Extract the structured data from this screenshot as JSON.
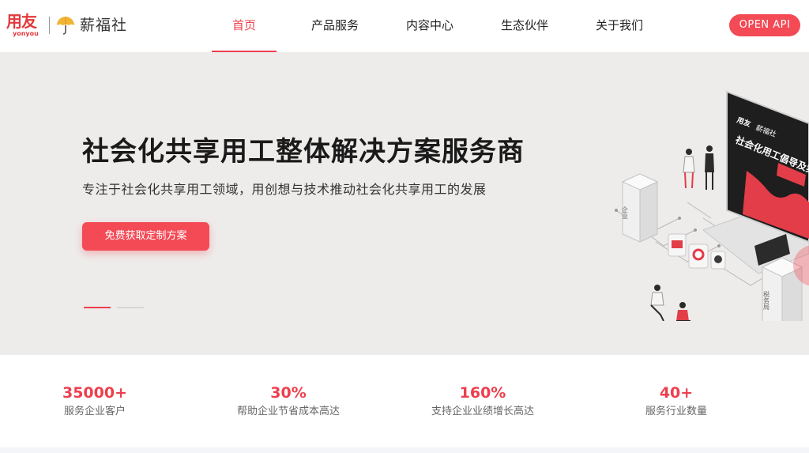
{
  "brand": {
    "yonyou_cn": "用友",
    "yonyou_en": "yonyou",
    "product_name": "薪福社"
  },
  "nav": {
    "items": [
      {
        "label": "首页",
        "active": true
      },
      {
        "label": "产品服务",
        "active": false
      },
      {
        "label": "内容中心",
        "active": false
      },
      {
        "label": "生态伙伴",
        "active": false
      },
      {
        "label": "关于我们",
        "active": false
      }
    ],
    "open_api_label": "OPEN API"
  },
  "hero": {
    "title": "社会化共享用工整体解决方案服务商",
    "subtitle": "专注于社会化共享用工领域，用创想与技术推动社会化共享用工的发展",
    "cta_label": "免费获取定制方案",
    "carousel_active_index": 0,
    "carousel_count": 2,
    "illustration": {
      "screen_brand_cn": "用友",
      "screen_brand_product": "薪福社",
      "screen_headline": "社会化用工倡导及实",
      "server_left_label": "企业",
      "server_right_label": "税务局"
    }
  },
  "stats": [
    {
      "value": "35000+",
      "label": "服务企业客户"
    },
    {
      "value": "30%",
      "label": "帮助企业节省成本高达"
    },
    {
      "value": "160%",
      "label": "支持企业业绩增长高达"
    },
    {
      "value": "40+",
      "label": "服务行业数量"
    }
  ],
  "colors": {
    "accent": "#ee3f4d",
    "button": "#f44a56",
    "hero_bg": "#eeeceb",
    "umbrella": "#f2b433"
  },
  "icons": [
    "umbrella-logo-icon"
  ]
}
